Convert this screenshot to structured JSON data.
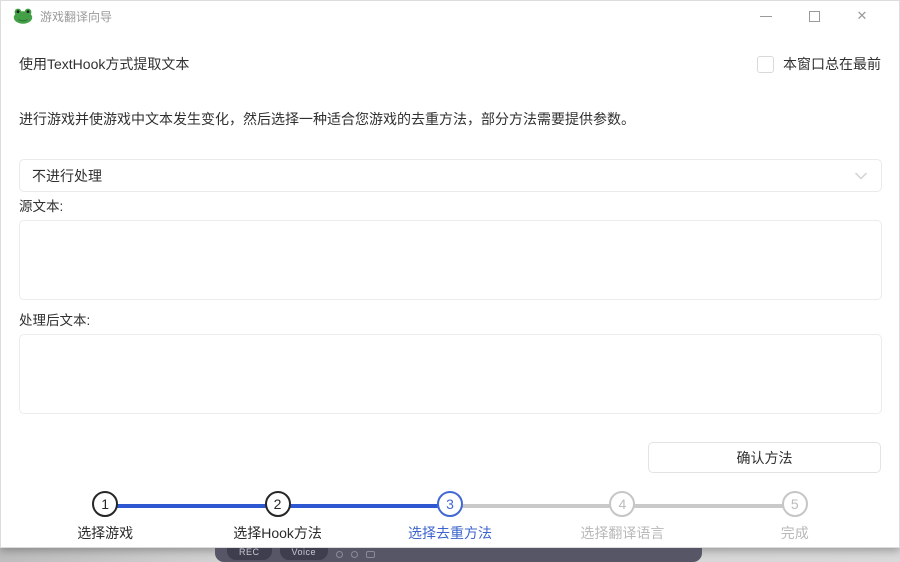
{
  "window": {
    "title": "游戏翻译向导",
    "app_icon": "frog-icon"
  },
  "header": {
    "mode_text": "使用TextHook方式提取文本",
    "always_on_top_label": "本窗口总在最前",
    "always_on_top_checked": false
  },
  "instruction": "进行游戏并使游戏中文本发生变化，然后选择一种适合您游戏的去重方法，部分方法需要提供参数。",
  "dedup_method_select": {
    "value": "不进行处理",
    "icon": "chevron-down-icon"
  },
  "source_text": {
    "label": "源文本:",
    "value": ""
  },
  "processed_text": {
    "label": "处理后文本:",
    "value": ""
  },
  "confirm_button_label": "确认方法",
  "stepper": {
    "active_step": 3,
    "steps": [
      {
        "number": "1",
        "label": "选择游戏",
        "state": "done"
      },
      {
        "number": "2",
        "label": "选择Hook方法",
        "state": "done"
      },
      {
        "number": "3",
        "label": "选择去重方法",
        "state": "active"
      },
      {
        "number": "4",
        "label": "选择翻译语言",
        "state": "pending"
      },
      {
        "number": "5",
        "label": "完成",
        "state": "pending"
      }
    ]
  },
  "recorder_bar": {
    "rec_label": "REC",
    "voice_label": "Voice"
  },
  "colors": {
    "accent_blue": "#2e58d2",
    "active_text_blue": "#3c64cc",
    "done_black": "#262626",
    "pending_gray": "#c6c6c6",
    "frog_green": "#43a047",
    "title_gray": "#9a9a9a"
  }
}
